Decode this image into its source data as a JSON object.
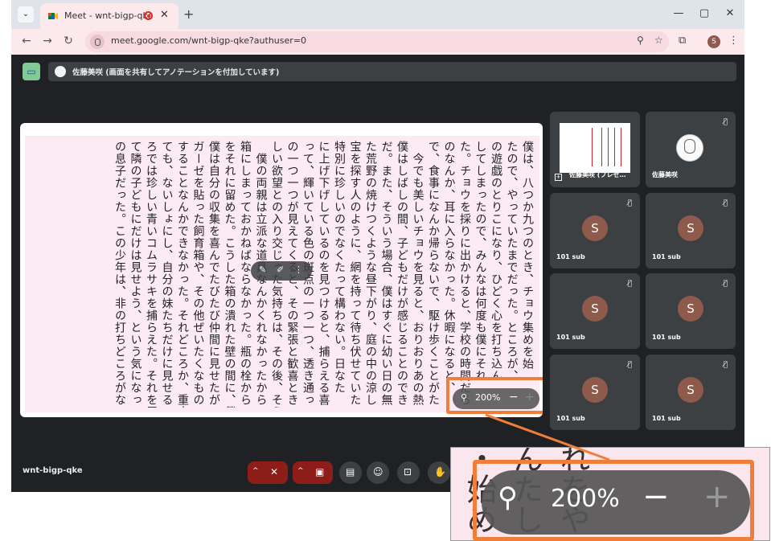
{
  "browser": {
    "tab_title": "Meet - wnt-bigp-qke",
    "url": "meet.google.com/wnt-bigp-qke?authuser=0",
    "profile_initial": "S"
  },
  "meet": {
    "presenting_banner": "佐藤美咲 (画面を共有してアノテーションを付加しています)",
    "meeting_code": "wnt-bigp-qke",
    "zoom_level": "200%",
    "zoom_out_label": "−",
    "zoom_in_label": "+",
    "participants": [
      {
        "name": "佐藤美咲 (プレゼ…",
        "type": "presentation"
      },
      {
        "name": "佐藤美咲",
        "type": "sketch"
      },
      {
        "name": "101 sub",
        "initial": "S"
      },
      {
        "name": "101 sub",
        "initial": "S"
      },
      {
        "name": "101 sub",
        "initial": "S"
      },
      {
        "name": "101 sub",
        "initial": "S"
      },
      {
        "name": "101 sub",
        "initial": "S"
      },
      {
        "name": "101 sub",
        "initial": "S"
      }
    ]
  },
  "document_columns": [
    "僕は、八つか九つのとき、チョウ集めを始",
    "たので、やっていたまでだった。ところが、",
    "の遊戯のとりこになり、ひどく心を打ち込ん",
    "してしまったので、みんなは何度も僕にそれ",
    "た。チョウを採りに出かけると、学校の時間だろ",
    "のなんか、耳に入らなかった。休暇になると、",
    "で、食事になんか帰らないで、駆け歩くことがた",
    "　今でも美しいチョウを見ると、おりおりあの熱",
    "僕はしばしの間、子どもだけが感じることのでき",
    "だ。また、そういう場合、僕はすぐに幼い日の無",
    "た荒野の焼けつくような昼下がり、庭の中の涼し",
    "宝を探す人のように、網を持って待ち伏せていた",
    "特別に珍しいのでなくたって構わない。日なた",
    "に上げ下げしているのを見つけると、捕らえる喜",
    "って、輝いている色の斑点の一つ一つ、透き通っ",
    "の一つ一つが見えてくると、その緊張と歓喜とき",
    "しい欲望との入り交じった気持ちは、その後、そう",
    "　僕の両親は立派な道具なんかくれなかったから",
    "箱にしまっておかねばならなかった。瓶の栓から",
    "をそれに留めた。こうした箱の潰れた壁の間に、僕",
    "僕は自分の収集を喜んでたびたび仲間に見せたが",
    "ガーゼを貼った飼育箱や、その他ぜいたくなもの",
    "することなんかできなかった。それどころか、重大",
    "ても、ないしょにし、自分の妹たちだけに見せる",
    "ろでは珍しい青いコムラサキを捕らえた。それを展",
    "て隣の子どもにだけは見せよう、という気になっ",
    "の息子だった。この少年は、非の打ちどころがな"
  ],
  "magnified_columns": [
    "れ",
    "を",
    "や"
  ],
  "magnified_columns2": [
    "ん",
    "た",
    "し"
  ],
  "magnified_columns3": [
    "・始",
    "め",
    "た"
  ],
  "controls": {
    "chevron": "^"
  }
}
